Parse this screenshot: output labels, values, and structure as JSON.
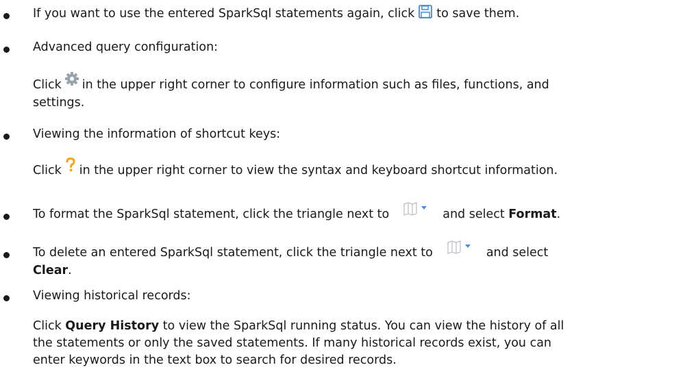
{
  "items": [
    {
      "id": "save",
      "before": "If you want to use the entered SparkSql statements again, click",
      "after": "to save them.",
      "icon": "save-icon"
    },
    {
      "id": "advanced",
      "heading": "Advanced query configuration:",
      "before": "Click",
      "after_line1": "in the upper right corner to configure information such as files, functions, and",
      "after_line2": "settings.",
      "icon": "gear-icon"
    },
    {
      "id": "shortcuts",
      "heading": "Viewing the information of shortcut keys:",
      "before": "Click",
      "after": "in the upper right corner to view the syntax and keyboard shortcut information.",
      "icon": "help-icon"
    },
    {
      "id": "format",
      "before": "To format the SparkSql statement, click the triangle next to",
      "after": "and select",
      "bold": "Format",
      "end": ".",
      "icon": "format-dropdown-icon"
    },
    {
      "id": "clear",
      "before": "To delete an entered SparkSql statement, click the triangle next to",
      "after": "and select",
      "bold": "Clear",
      "end": ".",
      "icon": "format-dropdown-icon"
    },
    {
      "id": "history",
      "heading": "Viewing historical records:",
      "click": "Click",
      "bold": "Query History",
      "rest_line1": "to view the SparkSql running status. You can view the history of all",
      "line2": "the statements or only the saved statements. If many historical records exist, you can",
      "line3": "enter keywords in the text box to search for desired records."
    }
  ]
}
